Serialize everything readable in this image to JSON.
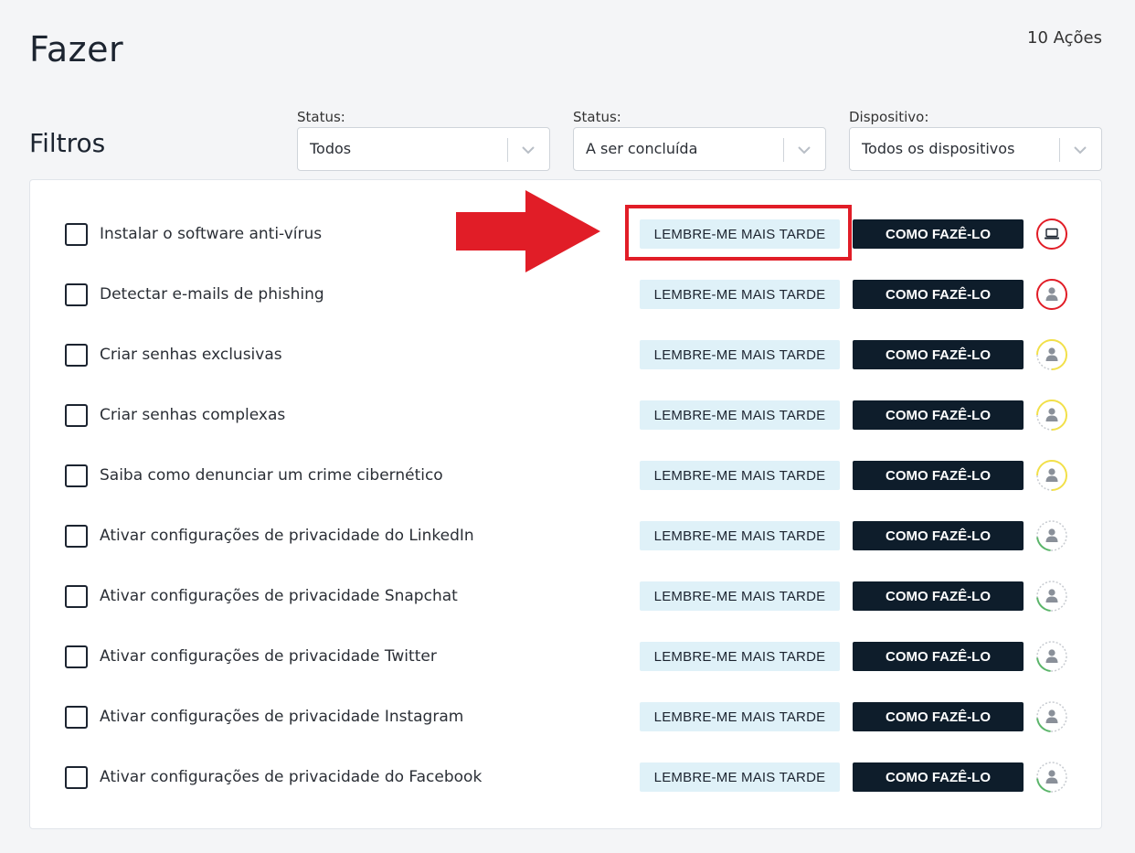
{
  "header": {
    "title": "Fazer",
    "action_count": "10 Ações"
  },
  "filters": {
    "title": "Filtros",
    "items": [
      {
        "label": "Status:",
        "value": "Todos"
      },
      {
        "label": "Status:",
        "value": "A ser concluída"
      },
      {
        "label": "Dispositivo:",
        "value": "Todos os dispositivos"
      }
    ]
  },
  "buttons": {
    "later_label": "LEMBRE-ME MAIS TARDE",
    "how_label": "COMO FAZÊ-LO"
  },
  "tasks": [
    {
      "label": "Instalar o software anti-vírus",
      "icon": "laptop-icon",
      "ring": "red"
    },
    {
      "label": "Detectar e-mails de phishing",
      "icon": "user-icon",
      "ring": "red"
    },
    {
      "label": "Criar senhas exclusivas",
      "icon": "user-icon",
      "ring": "yellow"
    },
    {
      "label": "Criar senhas complexas",
      "icon": "user-icon",
      "ring": "yellow"
    },
    {
      "label": "Saiba como denunciar um crime cibernético",
      "icon": "user-icon",
      "ring": "yellow"
    },
    {
      "label": "Ativar configurações de privacidade do LinkedIn",
      "icon": "user-icon",
      "ring": "green-partial"
    },
    {
      "label": "Ativar configurações de privacidade Snapchat",
      "icon": "user-icon",
      "ring": "green-partial"
    },
    {
      "label": "Ativar configurações de privacidade Twitter",
      "icon": "user-icon",
      "ring": "green-partial"
    },
    {
      "label": "Ativar configurações de privacidade Instagram",
      "icon": "user-icon",
      "ring": "green-partial"
    },
    {
      "label": "Ativar configurações de privacidade do Facebook",
      "icon": "user-icon",
      "ring": "green-partial"
    }
  ],
  "colors": {
    "ring_red": "#e11d27",
    "ring_yellow": "#f2e04a",
    "ring_green": "#5bb56a",
    "ring_grey": "#c8ccd1",
    "annotation": "#e11d27",
    "dark_button": "#0e1d2b",
    "light_button": "#dff1f8"
  }
}
